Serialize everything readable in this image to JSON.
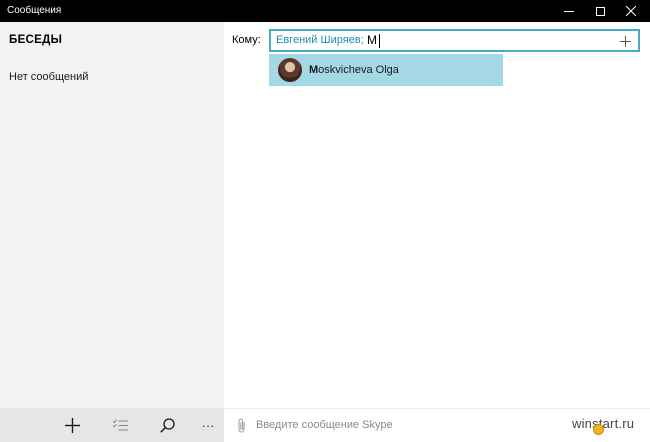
{
  "window": {
    "title": "Сообщения"
  },
  "sidebar": {
    "heading": "БЕСЕДЫ",
    "empty_text": "Нет сообщений",
    "toolbar": {
      "more_label": "···"
    }
  },
  "compose_header": {
    "to_label": "Кому:",
    "recipient": "Евгений Ширяев;",
    "typed_text": "M"
  },
  "suggestions": [
    {
      "match": "M",
      "rest": "oskvicheva Olga"
    }
  ],
  "compose": {
    "placeholder": "Введите сообщение Skype"
  },
  "watermark": "winstart.ru",
  "colors": {
    "accent": "#4aa9c4",
    "recipient_text": "#1b8fb5",
    "suggestion_bg": "#a5d8e6",
    "sidebar_bg": "#f2f2f2",
    "titlebar_bg": "#000000"
  },
  "icons": {
    "minimize": "minimize-icon",
    "maximize": "maximize-icon",
    "close": "close-icon",
    "new_conversation": "plus-icon",
    "select": "checklist-icon",
    "search": "search-icon",
    "more": "more-icon",
    "add_recipient": "plus-icon",
    "attach": "paperclip-icon"
  }
}
